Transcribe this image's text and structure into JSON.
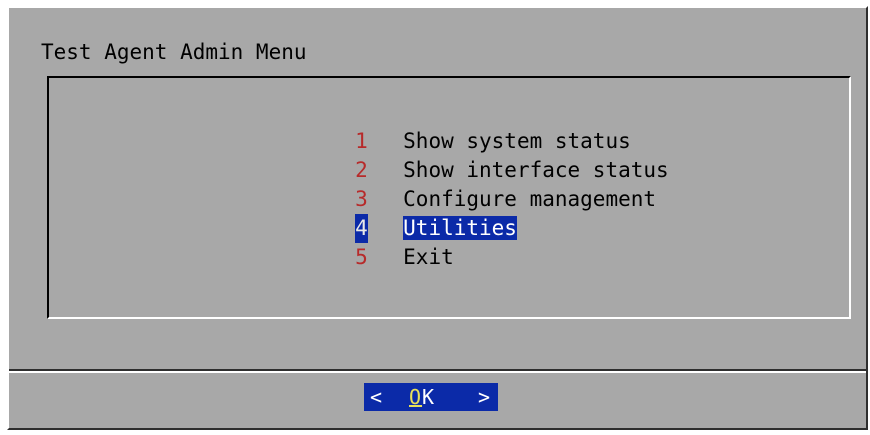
{
  "dialog": {
    "title": "Test Agent Admin Menu"
  },
  "menu": {
    "items": [
      {
        "tag": "1",
        "label": "Show system status",
        "selected": false
      },
      {
        "tag": "2",
        "label": "Show interface status",
        "selected": false
      },
      {
        "tag": "3",
        "label": "Configure management",
        "selected": false
      },
      {
        "tag": "4",
        "label": "Utilities",
        "selected": true
      },
      {
        "tag": "5",
        "label": "Exit",
        "selected": false
      }
    ]
  },
  "buttons": {
    "ok": {
      "left_bracket": "<",
      "hotkey": "O",
      "rest": "K",
      "right_bracket": ">"
    }
  },
  "colors": {
    "dialog_background": "#a8a8a8",
    "selection": "#0b2aa8",
    "tag": "#b72a2a",
    "hotkey": "#e8e05a"
  }
}
